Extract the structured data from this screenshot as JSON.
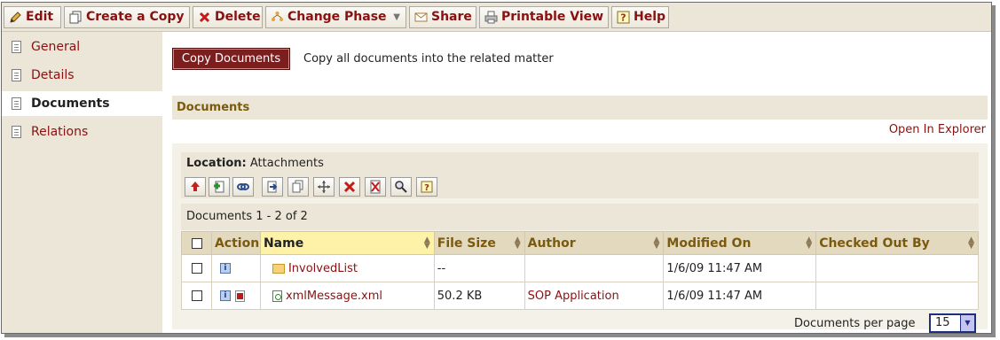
{
  "toolbar": {
    "buttons": [
      {
        "label": "Edit",
        "icon": "pencil-icon"
      },
      {
        "label": "Create a Copy",
        "icon": "copy-icon"
      },
      {
        "label": "Delete",
        "icon": "delete-x-icon"
      },
      {
        "label": "Change Phase",
        "icon": "phase-icon"
      },
      {
        "label": "Share",
        "icon": "envelope-icon"
      },
      {
        "label": "Printable View",
        "icon": "printer-icon"
      },
      {
        "label": "Help",
        "icon": "help-icon"
      }
    ]
  },
  "sidebar": {
    "items": [
      {
        "label": "General"
      },
      {
        "label": "Details"
      },
      {
        "label": "Documents",
        "active": true
      },
      {
        "label": "Relations"
      }
    ]
  },
  "main": {
    "copy_button": "Copy Documents",
    "copy_description": "Copy all documents into the related matter",
    "section_title": "Documents",
    "open_in_explorer": "Open In Explorer"
  },
  "location": {
    "label": "Location:",
    "value": "Attachments"
  },
  "icon_bar": [
    "upload-icon",
    "add-document-icon",
    "link-icon",
    "move-icon",
    "copy-icon",
    "move-arrows-icon",
    "delete-icon",
    "remove-pdf-icon",
    "search-icon",
    "help-icon"
  ],
  "documents": {
    "count_text": "Documents 1 - 2 of 2",
    "columns": [
      "Action",
      "Name",
      "File Size",
      "Author",
      "Modified On",
      "Checked Out By"
    ],
    "rows": [
      {
        "name": "InvolvedList",
        "type": "folder",
        "file_size": "--",
        "author": "",
        "modified_on": "1/6/09 11:47 AM",
        "checked_out_by": ""
      },
      {
        "name": "xmlMessage.xml",
        "type": "xml",
        "file_size": "50.2 KB",
        "author": "SOP Application",
        "modified_on": "1/6/09 11:47 AM",
        "checked_out_by": ""
      }
    ],
    "per_page_label": "Documents per page",
    "per_page_value": "15"
  }
}
